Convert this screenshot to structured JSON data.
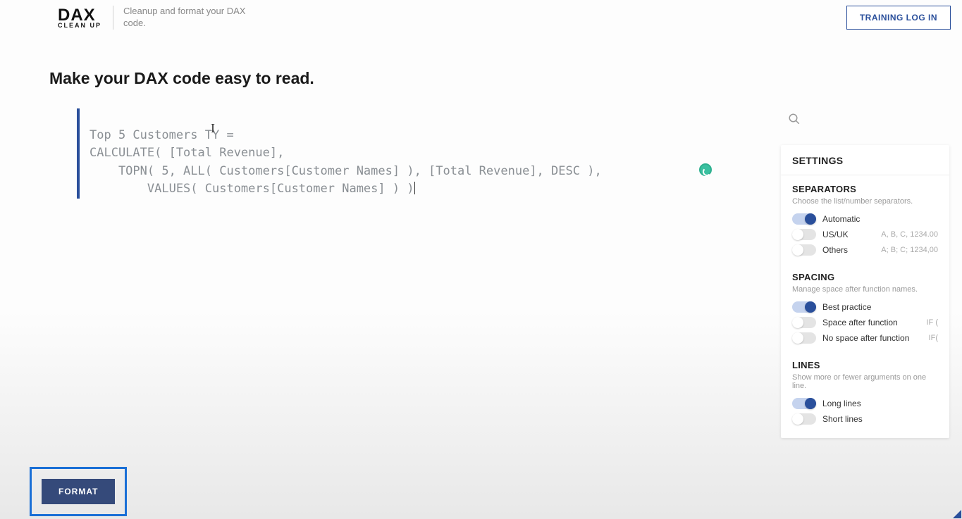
{
  "logo": {
    "main": "DAX",
    "sub": "CLEAN UP"
  },
  "tagline": "Cleanup and format your DAX code.",
  "training_login": "TRAINING LOG IN",
  "heading": "Make your DAX code easy to read.",
  "code": {
    "line1": "Top 5 Customers TY =",
    "line2": "CALCULATE( [Total Revenue],",
    "line3": "    TOPN( 5, ALL( Customers[Customer Names] ), [Total Revenue], DESC ),",
    "line4": "        VALUES( Customers[Customer Names] ) )"
  },
  "settings": {
    "title": "SETTINGS",
    "separators": {
      "title": "SEPARATORS",
      "desc": "Choose the list/number separators.",
      "automatic": "Automatic",
      "usuk": "US/UK",
      "usuk_hint": "A, B, C, 1234.00",
      "others": "Others",
      "others_hint": "A; B; C; 1234,00"
    },
    "spacing": {
      "title": "SPACING",
      "desc": "Manage space after function names.",
      "best": "Best practice",
      "space_after": "Space after function",
      "space_after_hint": "IF (",
      "no_space": "No space after function",
      "no_space_hint": "IF("
    },
    "lines": {
      "title": "LINES",
      "desc": "Show more or fewer arguments on one line.",
      "long": "Long lines",
      "short": "Short lines"
    }
  },
  "format_button": "FORMAT"
}
